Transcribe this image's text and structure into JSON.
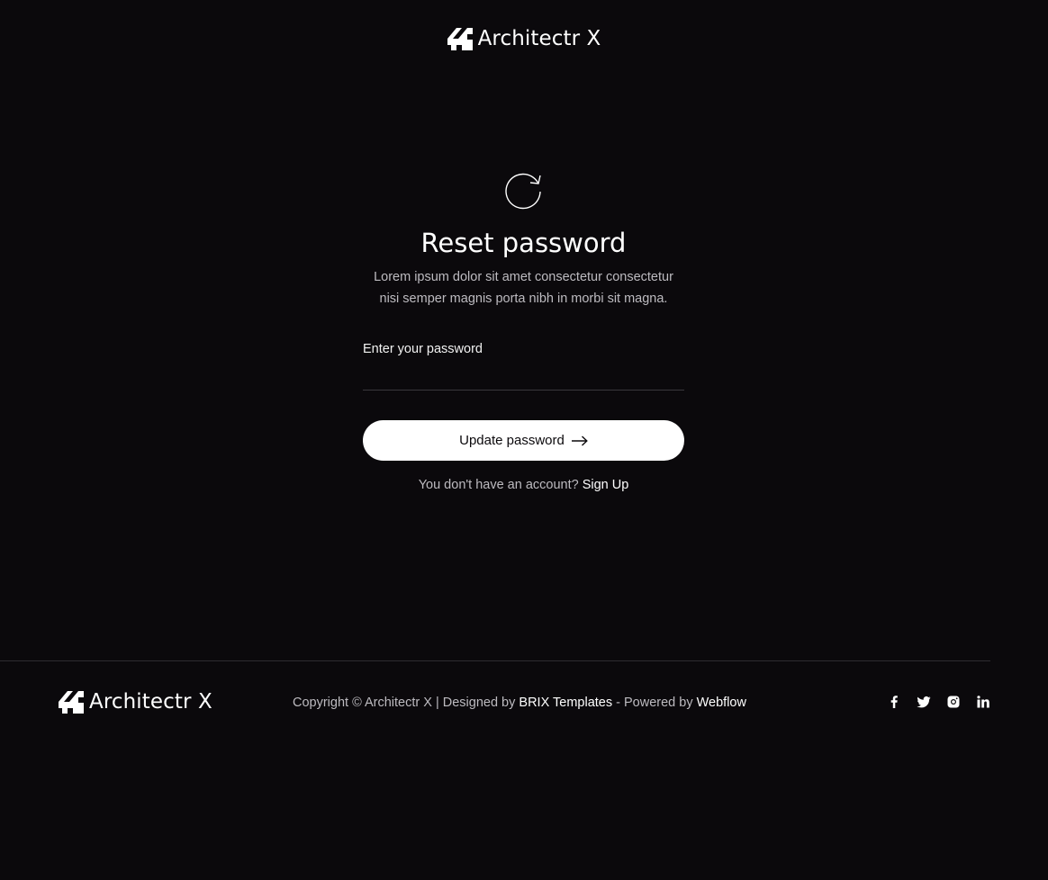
{
  "header": {
    "brand": "Architectr X"
  },
  "reset": {
    "icon": "refresh-icon",
    "title": "Reset password",
    "description": "Lorem ipsum dolor sit amet consectetur consectetur nisi semper magnis porta nibh in morbi sit magna.",
    "password_label": "Enter your password",
    "password_value": "",
    "button_label": "Update password",
    "button_icon": "arrow-right-icon",
    "signup_prompt": "You don't have an account?",
    "signup_link": "Sign Up"
  },
  "footer": {
    "brand": "Architectr X",
    "copyright_prefix": "Copyright © Architectr X | Designed by",
    "designer_link": "BRIX Templates",
    "powered_prefix": "- Powered by",
    "powered_link": "Webflow",
    "social_icons": [
      "facebook-icon",
      "twitter-icon",
      "instagram-icon",
      "linkedin-icon"
    ]
  },
  "colors": {
    "background": "#0b090c",
    "text": "#ffffff",
    "muted_text": "#bdbbc0",
    "button_bg": "#ffffff",
    "divider": "#2e2c30"
  }
}
